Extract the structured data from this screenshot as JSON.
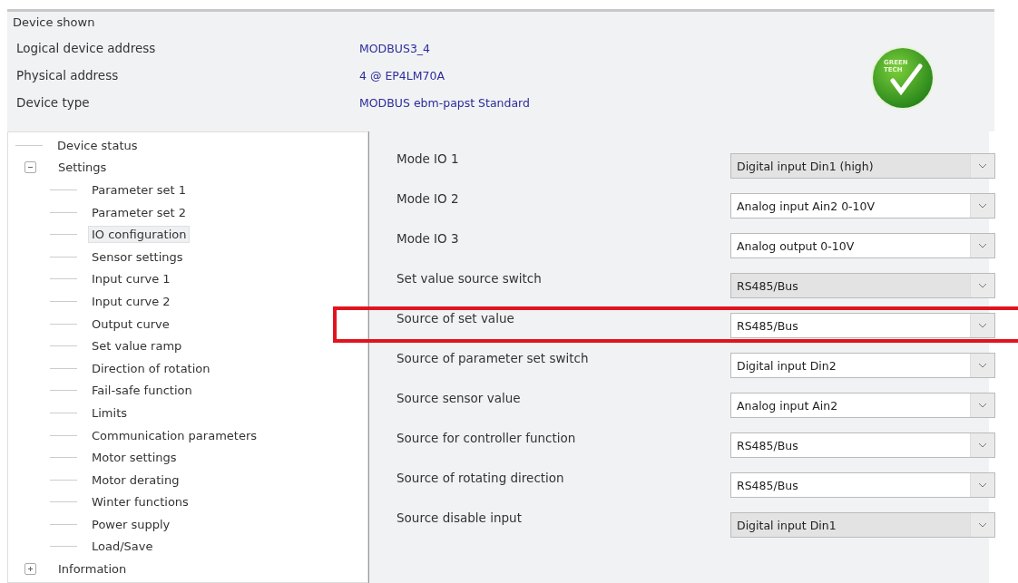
{
  "device_shown": {
    "title": "Device shown",
    "fields": [
      {
        "label": "Logical device address",
        "value": "MODBUS3_4"
      },
      {
        "label": "Physical address",
        "value": "4 @ EP4LM70A"
      },
      {
        "label": "Device type",
        "value": "MODBUS ebm-papst Standard"
      }
    ],
    "logo": {
      "text": "GREEN TECH"
    }
  },
  "tree": [
    {
      "label": "Device status",
      "selected": false
    },
    {
      "label": "Settings",
      "selected": false,
      "expanded": true,
      "children": [
        {
          "label": "Parameter set 1",
          "selected": false
        },
        {
          "label": "Parameter set 2",
          "selected": false
        },
        {
          "label": "IO configuration",
          "selected": true
        },
        {
          "label": "Sensor settings",
          "selected": false
        },
        {
          "label": "Input curve 1",
          "selected": false
        },
        {
          "label": "Input curve 2",
          "selected": false
        },
        {
          "label": "Output curve",
          "selected": false
        },
        {
          "label": "Set value ramp",
          "selected": false
        },
        {
          "label": "Direction of rotation",
          "selected": false
        },
        {
          "label": "Fail-safe function",
          "selected": false
        },
        {
          "label": "Limits",
          "selected": false
        },
        {
          "label": "Communication parameters",
          "selected": false
        },
        {
          "label": "Motor settings",
          "selected": false
        },
        {
          "label": "Motor derating",
          "selected": false
        },
        {
          "label": "Winter functions",
          "selected": false
        },
        {
          "label": "Power supply",
          "selected": false
        },
        {
          "label": "Load/Save",
          "selected": false
        }
      ]
    },
    {
      "label": "Information",
      "selected": false,
      "expanded": false
    }
  ],
  "settings": [
    {
      "label": "Mode IO 1",
      "value": "Digital input Din1 (high)",
      "disabled": true,
      "highlighted": false
    },
    {
      "label": "Mode IO 2",
      "value": "Analog input Ain2 0-10V",
      "disabled": false,
      "highlighted": false
    },
    {
      "label": "Mode IO 3",
      "value": "Analog output 0-10V",
      "disabled": false,
      "highlighted": false
    },
    {
      "label": "Set value source switch",
      "value": "RS485/Bus",
      "disabled": true,
      "highlighted": false
    },
    {
      "label": "Source of set value",
      "value": "RS485/Bus",
      "disabled": false,
      "highlighted": true
    },
    {
      "label": "Source of parameter set switch",
      "value": "Digital input Din2",
      "disabled": false,
      "highlighted": false
    },
    {
      "label": "Source sensor value",
      "value": "Analog input Ain2",
      "disabled": false,
      "highlighted": false
    },
    {
      "label": "Source for controller function",
      "value": "RS485/Bus",
      "disabled": false,
      "highlighted": false
    },
    {
      "label": "Source of rotating direction",
      "value": "RS485/Bus",
      "disabled": false,
      "highlighted": false
    },
    {
      "label": "Source disable input",
      "value": "Digital input Din1",
      "disabled": true,
      "highlighted": false
    }
  ]
}
